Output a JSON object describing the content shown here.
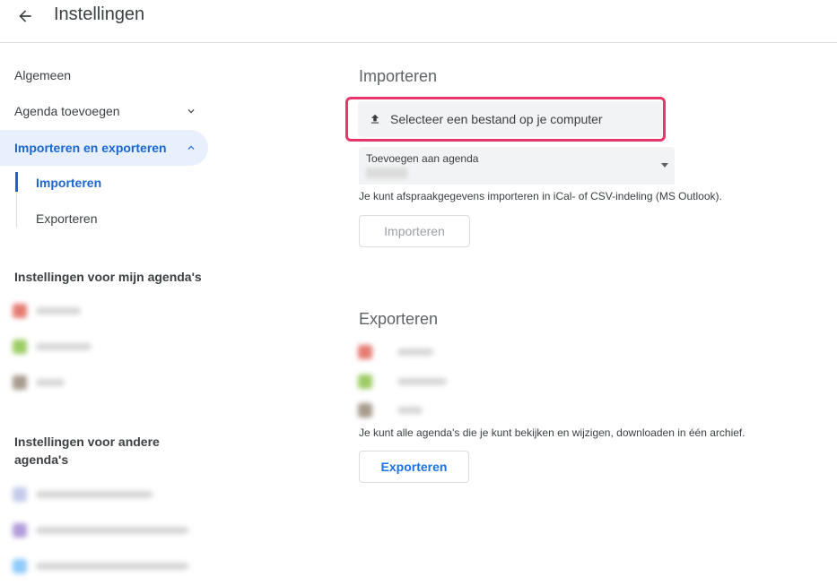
{
  "header": {
    "title": "Instellingen"
  },
  "sidebar": {
    "items": [
      {
        "label": "Algemeen"
      },
      {
        "label": "Agenda toevoegen"
      },
      {
        "label": "Importeren en exporteren"
      }
    ],
    "sub_items": [
      {
        "label": "Importeren"
      },
      {
        "label": "Exporteren"
      }
    ],
    "my_calendars_title": "Instellingen voor mijn agenda's",
    "other_calendars_title": "Instellingen voor andere agenda's"
  },
  "import": {
    "heading": "Importeren",
    "upload_label": "Selecteer een bestand op je computer",
    "select_label": "Toevoegen aan agenda",
    "help_text": "Je kunt afspraakgegevens importeren in iCal- of CSV-indeling (MS Outlook).",
    "button_label": "Importeren"
  },
  "export": {
    "heading": "Exporteren",
    "help_text": "Je kunt alle agenda's die je kunt bekijken en wijzigen, downloaden in één archief.",
    "button_label": "Exporteren"
  },
  "colors": {
    "accent": "#1967d2",
    "active_bg": "#e8f0fe",
    "highlight": "#e8356a",
    "calendar_red": "#e67c73",
    "calendar_green": "#7cb342",
    "calendar_brown": "#a79b8e",
    "calendar_lavender": "#7986cb",
    "calendar_purple": "#b39ddb",
    "calendar_blue": "#4285f4"
  },
  "icons": [
    "arrow-back-icon",
    "chevron-down-icon",
    "chevron-up-icon",
    "upload-icon",
    "dropdown-arrow-icon"
  ]
}
